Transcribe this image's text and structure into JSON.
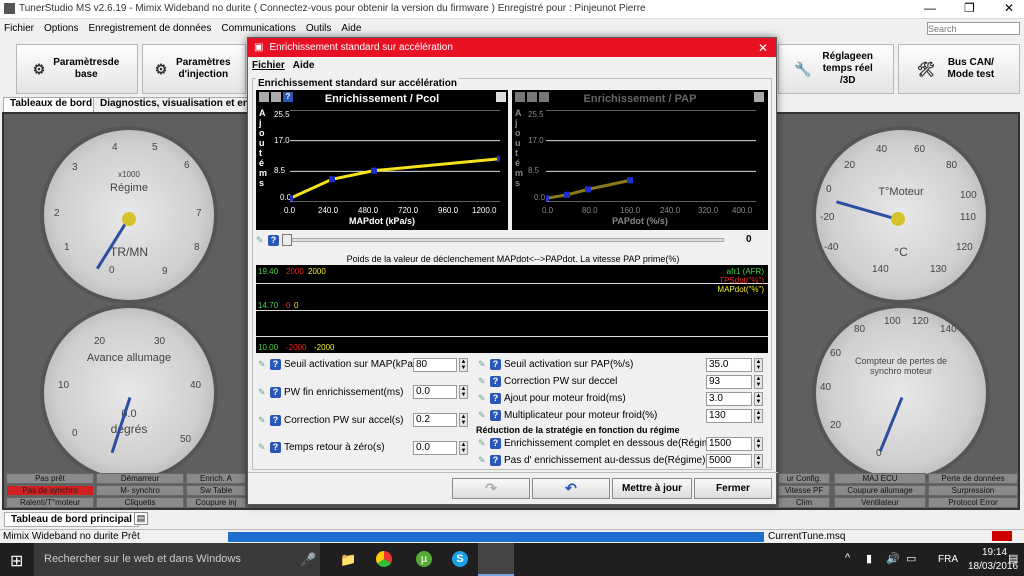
{
  "window": {
    "title": "TunerStudio MS v2.6.19 - Mimix Wideband no durite ( Connectez-vous pour obtenir la version du firmware ) Enregistré pour : Pinjeunot Pierre",
    "search_placeholder": "Search"
  },
  "menu": [
    "Fichier",
    "Options",
    "Enregistrement de données",
    "Communications",
    "Outils",
    "Aide"
  ],
  "toolbar": {
    "b1": "Paramètresde base",
    "b2": "Paramètres d'injection",
    "b3": "Réglageen temps réel /3D",
    "b4": "Bus CAN/ Mode test"
  },
  "tabs": [
    "Tableaux de bord",
    "Diagnostics, visualisation et enregi"
  ],
  "gauges": {
    "rpm": {
      "title": "Régime",
      "sub": "x1000",
      "unit": "TR/MN",
      "ticks": [
        "0",
        "1",
        "2",
        "3",
        "4",
        "5",
        "6",
        "7",
        "8",
        "9"
      ]
    },
    "advance": {
      "title": "Avance allumage",
      "unit": "degrés",
      "value": "0.0",
      "ticks": [
        "0",
        "10",
        "20",
        "30",
        "40",
        "50"
      ]
    },
    "engine": {
      "title": "T°Moteur",
      "unit": "°C",
      "ticks": [
        "-40",
        "-20",
        "0",
        "20",
        "40",
        "60",
        "80",
        "100",
        "110",
        "120",
        "130",
        "140"
      ]
    },
    "sync": {
      "title": "Compteur de pertes de synchro moteur",
      "value": "0",
      "ticks": [
        "0",
        "20",
        "40",
        "60",
        "80",
        "100",
        "120",
        "140"
      ]
    }
  },
  "indicators_left": [
    "Pas prêt",
    "Démarreur",
    "Enrich. A",
    "Pas de synchro",
    "M- synchro",
    "Sw Table",
    "Ralenti/T°moteur",
    "Cliquetis",
    "Coupure inj"
  ],
  "indicators_right": [
    "ur Config.",
    "MAJ ECU",
    "Perte de données",
    "Vitesse PF",
    "Coupure allumage",
    "Surpression",
    "Clim",
    "Ventilateur",
    "Protocol Error"
  ],
  "bottom_tab": "Tableau de bord principal",
  "dialog": {
    "title": "Enrichissement standard sur accélération",
    "menu": [
      "Fichier",
      "Aide"
    ],
    "group": "Enrichissement standard sur accélération",
    "plot1": {
      "title": "Enrichissement / Pcol",
      "xlabel": "MAPdot (kPa/s)",
      "ylabel": "A j o u t é ms",
      "yticks": [
        "25.5",
        "17.0",
        "8.5",
        "0.0"
      ],
      "xticks": [
        "0.0",
        "240.0",
        "480.0",
        "720.0",
        "960.0",
        "1200.0"
      ]
    },
    "plot2": {
      "title": "Enrichissement / PAP",
      "xlabel": "PAPdot (%/s)",
      "ylabel": "A j o u t é ms",
      "yticks": [
        "25.5",
        "17.0",
        "8.5",
        "0.0"
      ],
      "xticks": [
        "0.0",
        "80.0",
        "160.0",
        "240.0",
        "320.0",
        "400.0"
      ]
    },
    "slider_value": "0",
    "slider_label": "Poids de la valeur de déclenchement MAPdot<-->PAPdot. La vitesse PAP prime(%)",
    "trace": {
      "row1": [
        "19.40",
        "2000",
        "2000"
      ],
      "row2": [
        "14.70",
        "0",
        "0"
      ],
      "row3": [
        "10.00",
        "-2000",
        "-2000"
      ],
      "legend": [
        "afr1 (AFR)",
        "TPSdot(\"%\")",
        "MAPdot(\"%\")"
      ]
    },
    "left_fields": [
      {
        "label": "Seuil activation sur MAP(kPa/s)",
        "value": "80"
      },
      {
        "label": "PW fin enrichissement(ms)",
        "value": "0.0"
      },
      {
        "label": "Correction PW sur accel(s)",
        "value": "0.2"
      },
      {
        "label": "Temps retour à zéro(s)",
        "value": "0.0"
      }
    ],
    "right_fields": [
      {
        "label": "Seuil activation sur PAP(%/s)",
        "value": "35.0"
      },
      {
        "label": "Correction PW sur deccel",
        "value": "93"
      },
      {
        "label": "Ajout pour moteur froid(ms)",
        "value": "3.0"
      },
      {
        "label": "Multiplicateur pour moteur froid(%)",
        "value": "130"
      }
    ],
    "reduction_header": "Réduction de la stratégie en fonction du régime",
    "reduction_fields": [
      {
        "label": "Enrichissement complet en dessous de(Régime)",
        "value": "1500"
      },
      {
        "label": "Pas d' enrichissement au-dessus de(Régime)",
        "value": "5000"
      }
    ],
    "buttons": {
      "update": "Mettre à jour",
      "close": "Fermer"
    }
  },
  "chart_data": [
    {
      "type": "line",
      "title": "Enrichissement / Pcol",
      "xlabel": "MAPdot (kPa/s)",
      "ylabel": "Ajouté ms",
      "x": [
        0,
        240,
        480,
        1200
      ],
      "y": [
        1.0,
        6.3,
        8.7,
        12.0
      ],
      "xlim": [
        0,
        1200
      ],
      "ylim": [
        0,
        25.5
      ]
    },
    {
      "type": "line",
      "title": "Enrichissement / PAP",
      "xlabel": "PAPdot (%/s)",
      "ylabel": "Ajouté ms",
      "x": [
        0,
        40,
        80,
        160
      ],
      "y": [
        1.0,
        2.0,
        3.5,
        6.0
      ],
      "xlim": [
        0,
        400
      ],
      "ylim": [
        0,
        25.5
      ]
    }
  ],
  "status": {
    "left": "Mimix Wideband no durite Prêt",
    "right": "CurrentTune.msq"
  },
  "taskbar": {
    "search": "Rechercher sur le web et dans Windows",
    "lang": "FRA",
    "time": "19:14",
    "date": "18/03/2016"
  },
  "colors": {
    "accent_red": "#e81123",
    "plot_line": "#f4e21a",
    "point": "#1f2fd0"
  }
}
